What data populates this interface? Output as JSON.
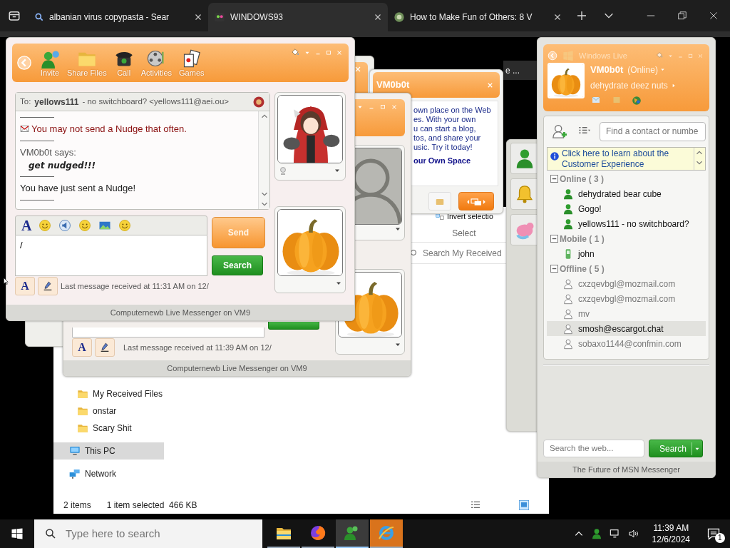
{
  "browser": {
    "tabs": [
      {
        "title": "albanian virus copypasta - Sear",
        "selected": false
      },
      {
        "title": "WINDOWS93",
        "selected": true
      },
      {
        "title": "How to Make Fun of Others: 8 V",
        "selected": false
      }
    ]
  },
  "explorer": {
    "hidden_title": "e ...",
    "ribbon_action": "Invert selectio",
    "ribbon_group": "Select",
    "search_placeholder": "Search My Received",
    "nav": [
      {
        "label": "My Received Files",
        "kind": "folder",
        "selected": false
      },
      {
        "label": "onstar",
        "kind": "folder",
        "selected": false
      },
      {
        "label": "Scary Shit",
        "kind": "folder",
        "selected": false
      },
      {
        "label": "This PC",
        "kind": "pc",
        "selected": true
      },
      {
        "label": "Network",
        "kind": "network",
        "selected": false
      }
    ],
    "status": [
      "2 items",
      "1 item selected  466 KB"
    ]
  },
  "spaces_popup": {
    "title": "VM0b0t",
    "lines": [
      "own place on the Web",
      "es. With your own",
      "u can start a blog,",
      "tos, and share your",
      "usic. Try it today!"
    ],
    "link": "our Own Space"
  },
  "back_chat": {
    "bottom_font": "A",
    "last_message": "Last message received at 11:39 AM on 12/",
    "footer": "Computernewb Live Messenger on VM9"
  },
  "chat": {
    "toolbar": [
      "Invite",
      "Share Files",
      "Call",
      "Activities",
      "Games"
    ],
    "to_label": "To:",
    "to_name": "yellows111",
    "to_rest": "- no switchboard? <yellows111@aei.ou>",
    "messages": [
      {
        "kind": "notice",
        "text": "You may not send a Nudge that often."
      },
      {
        "kind": "says",
        "sender": "VM0b0t says:",
        "text": "get nudged!!!"
      },
      {
        "kind": "plain",
        "text": "You have just sent a Nudge!"
      }
    ],
    "toolbar_font": "A",
    "input_value": "/",
    "send": "Send",
    "search": "Search",
    "bottom_font": "A",
    "last_message": "Last message received at 11:31 AM on 12/",
    "footer": "Computernewb Live Messenger on VM9"
  },
  "contacts": {
    "title": "Windows Live",
    "name": "VM0b0t",
    "status": "(Online)",
    "personal_message": "dehydrate deez nuts",
    "find_placeholder": "Find a contact or numbe",
    "banner": "Click here to learn about the Customer Experience",
    "groups": [
      {
        "label": "Online ( 3 )",
        "expanded": true,
        "contacts": [
          {
            "name": "dehydrated bear cube",
            "kind": "online",
            "selected": false
          },
          {
            "name": "Gogo!",
            "kind": "online",
            "selected": false
          },
          {
            "name": "yellows111 - no switchboard?",
            "kind": "online",
            "selected": false
          }
        ]
      },
      {
        "label": "Mobile ( 1 )",
        "expanded": true,
        "contacts": [
          {
            "name": "john",
            "kind": "mobile",
            "selected": false
          }
        ]
      },
      {
        "label": "Offline ( 5 )",
        "expanded": true,
        "contacts": [
          {
            "name": "cxzqevbgl@mozmail.com",
            "kind": "offline",
            "selected": false
          },
          {
            "name": "cxzqevbgl@mozmail.com",
            "kind": "offline",
            "selected": false
          },
          {
            "name": "mv",
            "kind": "offline",
            "selected": false
          },
          {
            "name": "smosh@escargot.chat",
            "kind": "offline",
            "selected": true
          },
          {
            "name": "sobaxo1144@confmin.com",
            "kind": "offline",
            "selected": false
          }
        ]
      }
    ],
    "web_search_placeholder": "Search the web...",
    "search_button": "Search",
    "footer": "The Future of MSN Messenger"
  },
  "taskbar": {
    "search_placeholder": "Type here to search",
    "apps": [
      {
        "kind": "explorer",
        "active": false,
        "flashing": false
      },
      {
        "kind": "firefox",
        "active": false,
        "flashing": false
      },
      {
        "kind": "messenger",
        "active": true,
        "flashing": false
      },
      {
        "kind": "ie",
        "active": false,
        "flashing": true
      }
    ],
    "time": "11:39 AM",
    "date": "12/6/2024",
    "notifications": "1"
  }
}
